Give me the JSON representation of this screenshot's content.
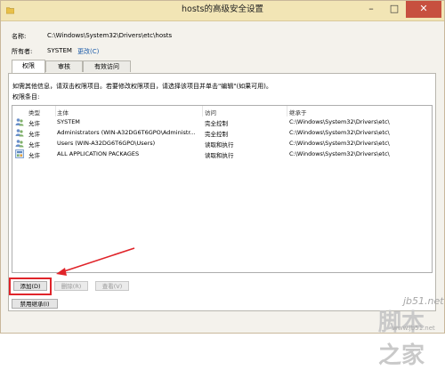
{
  "window": {
    "title": "hosts的高级安全设置",
    "controls": {
      "minimize": "–",
      "maximize": "□",
      "close": "✕"
    }
  },
  "info": {
    "name_label": "名称:",
    "name_value": "C:\\Windows\\System32\\Drivers\\etc\\hosts",
    "owner_label": "所有者:",
    "owner_value": "SYSTEM",
    "owner_change": "更改(C)"
  },
  "tabs": [
    {
      "label": "权限",
      "active": true
    },
    {
      "label": "审核",
      "active": false
    },
    {
      "label": "有效访问",
      "active": false
    }
  ],
  "instructions": "如需其他信息，请双击权限项目。若要修改权限项目，请选择该项目并单击\"编辑\"(如果可用)。",
  "entries_label": "权限条目:",
  "table": {
    "headers": [
      "类型",
      "主体",
      "访问",
      "继承于"
    ],
    "rows": [
      {
        "type": "允许",
        "principal": "SYSTEM",
        "access": "完全控制",
        "inherited": "C:\\Windows\\System32\\Drivers\\etc\\"
      },
      {
        "type": "允许",
        "principal": "Administrators (WIN-A32DG6T6GPO\\Administr...",
        "access": "完全控制",
        "inherited": "C:\\Windows\\System32\\Drivers\\etc\\"
      },
      {
        "type": "允许",
        "principal": "Users (WIN-A32DG6T6GPO\\Users)",
        "access": "读取和执行",
        "inherited": "C:\\Windows\\System32\\Drivers\\etc\\"
      },
      {
        "type": "允许",
        "principal": "ALL APPLICATION PACKAGES",
        "access": "读取和执行",
        "inherited": "C:\\Windows\\System32\\Drivers\\etc\\"
      }
    ]
  },
  "buttons": {
    "add": "添加(D)",
    "remove": "删除(R)",
    "view": "查看(V)",
    "disable_inheritance": "禁用继承(I)"
  },
  "watermark": {
    "site": "jb51.net",
    "logo": "脚本之家",
    "url": "www.jb51.net"
  },
  "colors": {
    "titlebar": "#f2e5b5",
    "close_button": "#c7503f",
    "highlight": "#e0242a",
    "link": "#1a5aa8"
  }
}
